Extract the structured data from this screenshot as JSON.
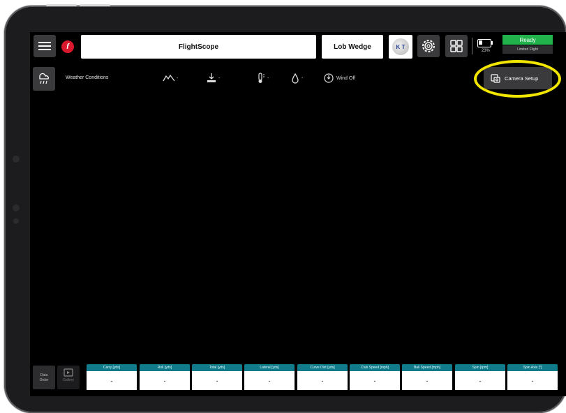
{
  "topbar": {
    "title": "FlightScope",
    "club": "Lob Wedge",
    "avatar_initials": "K T",
    "battery_percent": "23%",
    "status": "Ready",
    "substatus": "Limited Flight"
  },
  "weather": {
    "label": "Weather Conditions",
    "altitude": "-",
    "pressure": "-",
    "temperature": "-",
    "humidity": "-",
    "wind": "Wind Off"
  },
  "camera_setup": {
    "label": "Camera Setup"
  },
  "bottom": {
    "data_order_label": "Data Order",
    "gallery_label": "Gallery",
    "metrics": [
      {
        "label": "Carry [yds]",
        "value": "-"
      },
      {
        "label": "Roll [yds]",
        "value": "-"
      },
      {
        "label": "Total [yds]",
        "value": "-"
      },
      {
        "label": "Lateral [yds]",
        "value": "-"
      },
      {
        "label": "Curve Dist [yds]",
        "value": "-"
      },
      {
        "label": "Club Speed [mph]",
        "value": "-"
      },
      {
        "label": "Ball Speed [mph]",
        "value": "-"
      },
      {
        "label": "Spin [rpm]",
        "value": "-"
      },
      {
        "label": "Spin Axis [°]",
        "value": "-"
      }
    ]
  },
  "colors": {
    "status_green": "#22b24c",
    "metric_header_teal": "#117a8b",
    "highlight_yellow": "#f2e600",
    "logo_red": "#d9182d"
  },
  "icons": [
    "menu-icon",
    "flightscope-logo-icon",
    "settings-gear-icon",
    "grid-layout-icon",
    "battery-icon",
    "weather-icon",
    "altitude-icon",
    "pressure-icon",
    "temperature-icon",
    "humidity-icon",
    "wind-icon",
    "camera-setup-icon",
    "gallery-icon"
  ]
}
